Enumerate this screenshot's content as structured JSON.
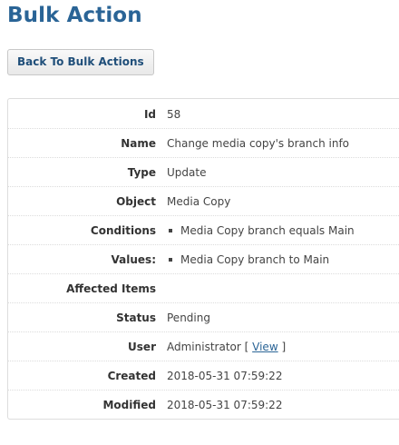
{
  "page": {
    "title": "Bulk Action"
  },
  "toolbar": {
    "back_label": "Back To Bulk Actions"
  },
  "details": {
    "id": {
      "label": "Id",
      "value": "58"
    },
    "name": {
      "label": "Name",
      "value": "Change media copy's branch info"
    },
    "type": {
      "label": "Type",
      "value": "Update"
    },
    "object": {
      "label": "Object",
      "value": "Media Copy"
    },
    "conditions": {
      "label": "Conditions",
      "items": [
        "Media Copy branch equals Main"
      ]
    },
    "values": {
      "label": "Values:",
      "items": [
        "Media Copy branch to Main"
      ]
    },
    "affected_items": {
      "label": "Affected Items",
      "value": ""
    },
    "status": {
      "label": "Status",
      "value": "Pending"
    },
    "user": {
      "label": "User",
      "name": "Administrator",
      "open_bracket": "[",
      "link_label": "View",
      "close_bracket": "]"
    },
    "created": {
      "label": "Created",
      "value": "2018-05-31 07:59:22"
    },
    "modified": {
      "label": "Modified",
      "value": "2018-05-31 07:59:22"
    }
  },
  "colors": {
    "title": "#2a6496",
    "link": "#2a6496",
    "button_text": "#1f4e79",
    "border": "#dddddd"
  }
}
